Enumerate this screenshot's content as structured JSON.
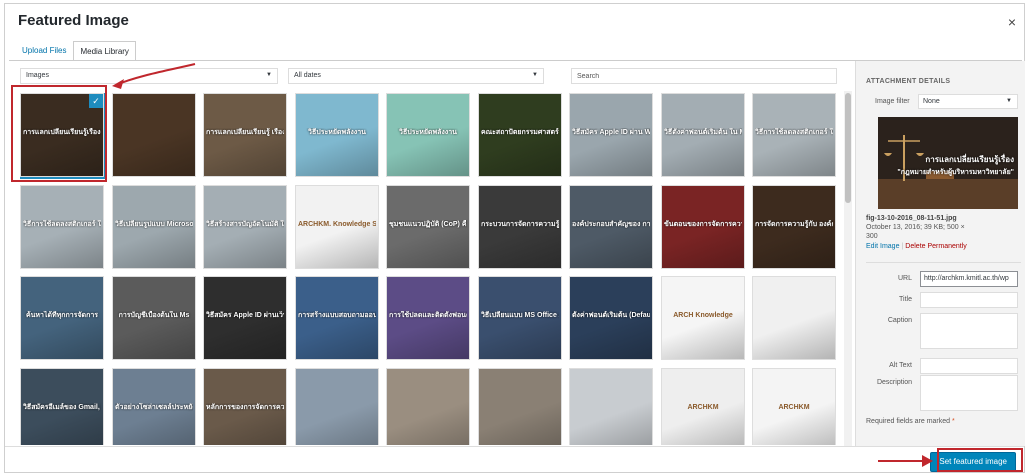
{
  "modal": {
    "title": "Featured Image",
    "close_glyph": "×"
  },
  "tabs": [
    {
      "label": "Upload Files",
      "active": false
    },
    {
      "label": "Media Library",
      "active": true
    }
  ],
  "toolbar": {
    "type_filter": "Images",
    "date_filter": "All dates",
    "search_placeholder": "Search"
  },
  "thumbnails": [
    {
      "caption": "การแลกเปลี่ยนเรียนรู้เรื่อง กฎหมายสำหรับผู้บริหารมหาวิทยาลัย",
      "color": "#3a2c20",
      "selected": true
    },
    {
      "caption": "",
      "color": "#4a3524"
    },
    {
      "caption": "การแลกเปลี่ยนเรียนรู้ เรื่อง กฎหมายสำหรับผู้บริหาร",
      "color": "#6d5a46"
    },
    {
      "caption": "วิธีประหยัดพลังงาน",
      "color": "#7fb8cf"
    },
    {
      "caption": "วิธีประหยัดพลังงาน",
      "color": "#86c3b5"
    },
    {
      "caption": "คณะสถาปัตยกรรมศาสตร์ FACULTY OF ARCHITECTURE",
      "color": "#2f3d1f"
    },
    {
      "caption": "วิธีสมัคร Apple ID ผ่าน Website Apple",
      "color": "#9aa6ad"
    },
    {
      "caption": "วิธีตั้งค่าฟอนต์เริ่มต้น ใน Microsoft Word",
      "color": "#a3adb3"
    },
    {
      "caption": "วิธีการใช้ลดลงสติกเกอร์ ในระบบปฏิบัติการ Mac OS",
      "color": "#a9b2b7"
    },
    {
      "caption": "วิธีการใช้ลดลงสติกเกอร์ ในระบบปฏิบัติการ Windows",
      "color": "#a6b0b6"
    },
    {
      "caption": "วิธีเปลี่ยนรูปแบบ Microsoft Office จากภาษาอังกฤษเป็นภาษาไทย",
      "color": "#9da8ae"
    },
    {
      "caption": "วิธีสร้างสารบัญอัตโนมัติ ใน Microsoft Word",
      "color": "#a4aeb4"
    },
    {
      "caption": "ARCHKM. Knowledge Sharing",
      "color": "#f2f2f2"
    },
    {
      "caption": "ชุมชนแนวปฏิบัติ (CoP) คืออะไร",
      "color": "#6b6b6b"
    },
    {
      "caption": "กระบวนการจัดการความรู้",
      "color": "#3a3a3a"
    },
    {
      "caption": "องค์ประกอบสำคัญของ การจัดการความรู้",
      "color": "#4e5a66"
    },
    {
      "caption": "ขั้นตอนของการจัดการความรู้",
      "color": "#7a2424"
    },
    {
      "caption": "การจัดการความรู้กับ องค์กรแห่งการเรียนรู้",
      "color": "#3d2b1e"
    },
    {
      "caption": "ค้นหาได้ที่ทุกการจัดการ",
      "color": "#44637d"
    },
    {
      "caption": "การบัญชีเบื้องต้นใน Ms",
      "color": "#5b5b5b"
    },
    {
      "caption": "วิธีสมัคร Apple ID ผ่านเว็บไซต์",
      "color": "#2e2e2e"
    },
    {
      "caption": "การสร้างแบบสอบถามออนไลน์ ด้วย Google Form",
      "color": "#3b5f8a"
    },
    {
      "caption": "การใช้ปลดและติดตั้งฟอนต์ ระบบปฏิบัติการ Windows",
      "color": "#5c4c86"
    },
    {
      "caption": "วิธีเปลี่ยนแบบ MS Office ภาษาอังกฤษเป็นภาษาไทย",
      "color": "#3a4f6e"
    },
    {
      "caption": "ตั้งค่าฟอนต์เริ่มต้น (Default) ใน Microsoft Word",
      "color": "#2b3f5a"
    },
    {
      "caption": "ARCH Knowledge",
      "color": "#f5f5f5"
    },
    {
      "caption": "",
      "color": "#f0f0f0"
    },
    {
      "caption": "วิธีสมัครอีเมล์ของ Gmail, Hotmail และ Yahoo",
      "color": "#3c4d5c"
    },
    {
      "caption": "ตัวอย่างโซล่าเซลล์ประหยัดพลังงาน",
      "color": "#6d7f92"
    },
    {
      "caption": "หลักการของการจัดการความรู้",
      "color": "#6a5a4a"
    },
    {
      "caption": "",
      "color": "#8a9aaa"
    },
    {
      "caption": "",
      "color": "#9a8e80"
    },
    {
      "caption": "",
      "color": "#8a8074"
    },
    {
      "caption": "",
      "color": "#c8ccd0"
    },
    {
      "caption": "ARCHKM",
      "color": "#eeeeee"
    },
    {
      "caption": "ARCHKM",
      "color": "#f4f4f4"
    }
  ],
  "details": {
    "heading": "ATTACHMENT DETAILS",
    "image_filter_label": "Image filter",
    "image_filter_value": "None",
    "preview_caption_1": "การแลกเปลี่ยนเรียนรู้เรื่อง",
    "preview_caption_2": "\"กฎหมายสำหรับผู้บริหารมหาวิทยาลัย\"",
    "filename": "fig-13-10-2016_08-11-51.jpg",
    "date_info": "October 13, 2016; 39 KB; 500 ×",
    "height_info": "300",
    "edit_link": "Edit Image",
    "delete_link": "Delete Permanently",
    "url_label": "URL",
    "url_value": "http://archkm.kmitl.ac.th/wp",
    "title_label": "Title",
    "caption_label": "Caption",
    "alt_label": "Alt Text",
    "description_label": "Description",
    "required_note": "Required fields are marked",
    "required_star": "*"
  },
  "footer": {
    "set_featured_label": "Set featured image"
  },
  "colors": {
    "accent": "#0085ba",
    "annotation": "#c0272d",
    "selection": "#1e8cbe"
  }
}
